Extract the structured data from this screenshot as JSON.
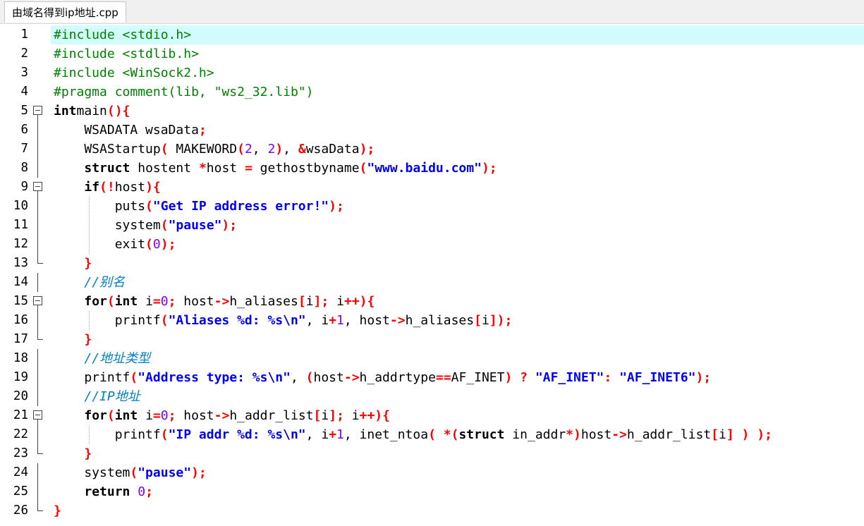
{
  "tab": {
    "label": "由域名得到ip地址.cpp"
  },
  "editor": {
    "current_line": 1,
    "lines": [
      {
        "n": "1",
        "fold": "none",
        "tokens": [
          [
            "pp",
            "#include <stdio.h>"
          ]
        ]
      },
      {
        "n": "2",
        "fold": "none",
        "tokens": [
          [
            "pp",
            "#include <stdlib.h>"
          ]
        ]
      },
      {
        "n": "3",
        "fold": "none",
        "tokens": [
          [
            "pp",
            "#include <WinSock2.h>"
          ]
        ]
      },
      {
        "n": "4",
        "fold": "none",
        "tokens": [
          [
            "pp",
            "#pragma comment(lib, \"ws2_32.lib\")"
          ]
        ]
      },
      {
        "n": "5",
        "fold": "open",
        "tokens": [
          [
            "kw",
            "int"
          ],
          [
            "",
            "main"
          ],
          [
            "op",
            "(){"
          ]
        ]
      },
      {
        "n": "6",
        "fold": "line",
        "tokens": [
          [
            "",
            "    WSADATA wsaData"
          ],
          [
            "op",
            ";"
          ]
        ]
      },
      {
        "n": "7",
        "fold": "line",
        "tokens": [
          [
            "",
            "    WSAStartup"
          ],
          [
            "op",
            "("
          ],
          [
            "",
            " MAKEWORD"
          ],
          [
            "op",
            "("
          ],
          [
            "num",
            "2"
          ],
          [
            "",
            ", "
          ],
          [
            "num",
            "2"
          ],
          [
            "op",
            ")"
          ],
          [
            "",
            ", "
          ],
          [
            "op",
            "&"
          ],
          [
            "",
            "wsaData"
          ],
          [
            "op",
            ");"
          ]
        ]
      },
      {
        "n": "8",
        "fold": "line",
        "tokens": [
          [
            "",
            "    "
          ],
          [
            "kw",
            "struct"
          ],
          [
            "",
            " hostent "
          ],
          [
            "op",
            "*"
          ],
          [
            "",
            "host "
          ],
          [
            "op",
            "="
          ],
          [
            "",
            " gethostbyname"
          ],
          [
            "op",
            "("
          ],
          [
            "str",
            "\"www.baidu.com\""
          ],
          [
            "op",
            ");"
          ]
        ]
      },
      {
        "n": "9",
        "fold": "open",
        "tokens": [
          [
            "",
            "    "
          ],
          [
            "kw",
            "if"
          ],
          [
            "op",
            "(!"
          ],
          [
            "",
            "host"
          ],
          [
            "op",
            "){"
          ]
        ]
      },
      {
        "n": "10",
        "fold": "line",
        "tokens": [
          [
            "",
            "        puts"
          ],
          [
            "op",
            "("
          ],
          [
            "str",
            "\"Get IP address error!\""
          ],
          [
            "op",
            ");"
          ]
        ]
      },
      {
        "n": "11",
        "fold": "line",
        "tokens": [
          [
            "",
            "        system"
          ],
          [
            "op",
            "("
          ],
          [
            "str",
            "\"pause\""
          ],
          [
            "op",
            ");"
          ]
        ]
      },
      {
        "n": "12",
        "fold": "line",
        "tokens": [
          [
            "",
            "        exit"
          ],
          [
            "op",
            "("
          ],
          [
            "num",
            "0"
          ],
          [
            "op",
            ");"
          ]
        ]
      },
      {
        "n": "13",
        "fold": "end",
        "tokens": [
          [
            "",
            "    "
          ],
          [
            "op",
            "}"
          ]
        ]
      },
      {
        "n": "14",
        "fold": "line",
        "tokens": [
          [
            "",
            "    "
          ],
          [
            "cmt",
            "//别名"
          ]
        ]
      },
      {
        "n": "15",
        "fold": "open",
        "tokens": [
          [
            "",
            "    "
          ],
          [
            "kw",
            "for"
          ],
          [
            "op",
            "("
          ],
          [
            "kw",
            "int"
          ],
          [
            "",
            " i"
          ],
          [
            "op",
            "="
          ],
          [
            "num",
            "0"
          ],
          [
            "op",
            ";"
          ],
          [
            "",
            " host"
          ],
          [
            "op",
            "->"
          ],
          [
            "",
            "h_aliases"
          ],
          [
            "op",
            "["
          ],
          [
            "",
            "i"
          ],
          [
            "op",
            "];"
          ],
          [
            "",
            " i"
          ],
          [
            "op",
            "++){"
          ]
        ]
      },
      {
        "n": "16",
        "fold": "line",
        "tokens": [
          [
            "",
            "        printf"
          ],
          [
            "op",
            "("
          ],
          [
            "str",
            "\"Aliases %d: %s\\n\""
          ],
          [
            "",
            ", i"
          ],
          [
            "op",
            "+"
          ],
          [
            "num",
            "1"
          ],
          [
            "",
            ", host"
          ],
          [
            "op",
            "->"
          ],
          [
            "",
            "h_aliases"
          ],
          [
            "op",
            "["
          ],
          [
            "",
            "i"
          ],
          [
            "op",
            "]);"
          ]
        ]
      },
      {
        "n": "17",
        "fold": "end",
        "tokens": [
          [
            "",
            "    "
          ],
          [
            "op",
            "}"
          ]
        ]
      },
      {
        "n": "18",
        "fold": "line",
        "tokens": [
          [
            "",
            "    "
          ],
          [
            "cmt",
            "//地址类型"
          ]
        ]
      },
      {
        "n": "19",
        "fold": "line",
        "tokens": [
          [
            "",
            "    printf"
          ],
          [
            "op",
            "("
          ],
          [
            "str",
            "\"Address type: %s\\n\""
          ],
          [
            "",
            ", "
          ],
          [
            "op",
            "("
          ],
          [
            "",
            "host"
          ],
          [
            "op",
            "->"
          ],
          [
            "",
            "h_addrtype"
          ],
          [
            "op",
            "=="
          ],
          [
            "",
            "AF_INET"
          ],
          [
            "op",
            ")"
          ],
          [
            "",
            " "
          ],
          [
            "op",
            "?"
          ],
          [
            "",
            " "
          ],
          [
            "str",
            "\"AF_INET\""
          ],
          [
            "op",
            ":"
          ],
          [
            "",
            " "
          ],
          [
            "str",
            "\"AF_INET6\""
          ],
          [
            "op",
            ");"
          ]
        ]
      },
      {
        "n": "20",
        "fold": "line",
        "tokens": [
          [
            "",
            "    "
          ],
          [
            "cmt",
            "//IP地址"
          ]
        ]
      },
      {
        "n": "21",
        "fold": "open",
        "tokens": [
          [
            "",
            "    "
          ],
          [
            "kw",
            "for"
          ],
          [
            "op",
            "("
          ],
          [
            "kw",
            "int"
          ],
          [
            "",
            " i"
          ],
          [
            "op",
            "="
          ],
          [
            "num",
            "0"
          ],
          [
            "op",
            ";"
          ],
          [
            "",
            " host"
          ],
          [
            "op",
            "->"
          ],
          [
            "",
            "h_addr_list"
          ],
          [
            "op",
            "["
          ],
          [
            "",
            "i"
          ],
          [
            "op",
            "];"
          ],
          [
            "",
            " i"
          ],
          [
            "op",
            "++){"
          ]
        ]
      },
      {
        "n": "22",
        "fold": "line",
        "tokens": [
          [
            "",
            "        printf"
          ],
          [
            "op",
            "("
          ],
          [
            "str",
            "\"IP addr %d: %s\\n\""
          ],
          [
            "",
            ", i"
          ],
          [
            "op",
            "+"
          ],
          [
            "num",
            "1"
          ],
          [
            "",
            ", inet_ntoa"
          ],
          [
            "op",
            "("
          ],
          [
            "",
            " "
          ],
          [
            "op",
            "*("
          ],
          [
            "kw",
            "struct"
          ],
          [
            "",
            " in_addr"
          ],
          [
            "op",
            "*)"
          ],
          [
            "",
            "host"
          ],
          [
            "op",
            "->"
          ],
          [
            "",
            "h_addr_list"
          ],
          [
            "op",
            "["
          ],
          [
            "",
            "i"
          ],
          [
            "op",
            "]"
          ],
          [
            "",
            " "
          ],
          [
            "op",
            ")"
          ],
          [
            "",
            " "
          ],
          [
            "op",
            ");"
          ]
        ]
      },
      {
        "n": "23",
        "fold": "end",
        "tokens": [
          [
            "",
            "    "
          ],
          [
            "op",
            "}"
          ]
        ]
      },
      {
        "n": "24",
        "fold": "line",
        "tokens": [
          [
            "",
            "    system"
          ],
          [
            "op",
            "("
          ],
          [
            "str",
            "\"pause\""
          ],
          [
            "op",
            ");"
          ]
        ]
      },
      {
        "n": "25",
        "fold": "line",
        "tokens": [
          [
            "",
            "    "
          ],
          [
            "kw",
            "return"
          ],
          [
            "",
            " "
          ],
          [
            "num",
            "0"
          ],
          [
            "op",
            ";"
          ]
        ]
      },
      {
        "n": "26",
        "fold": "end",
        "tokens": [
          [
            "op",
            "}"
          ]
        ]
      }
    ]
  }
}
